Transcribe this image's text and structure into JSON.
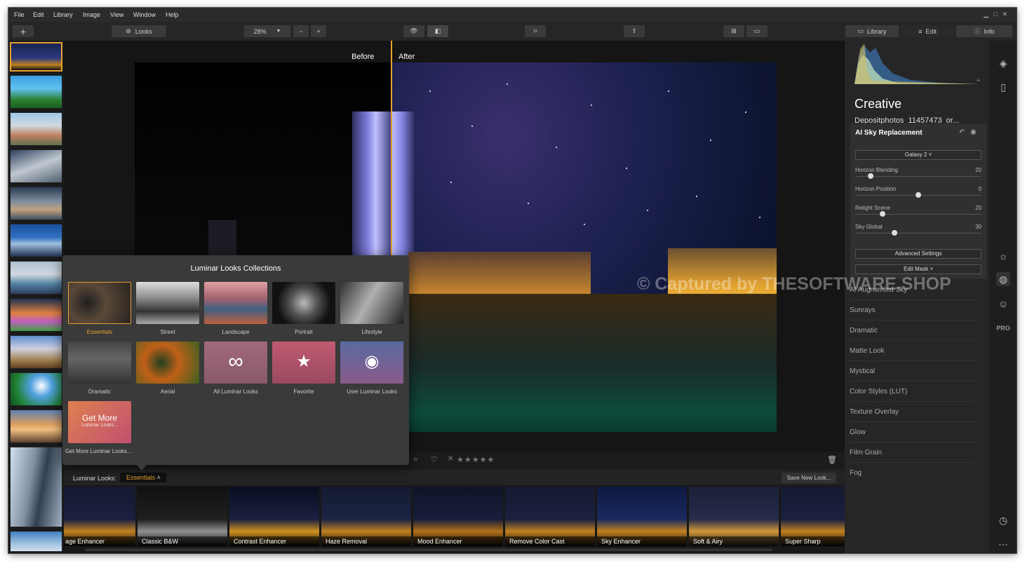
{
  "menu": [
    "File",
    "Edit",
    "Library",
    "Image",
    "View",
    "Window",
    "Help"
  ],
  "toolbar": {
    "looks": "Looks",
    "zoom": "28%",
    "library": "Library",
    "edit": "Edit",
    "info": "Info"
  },
  "compare": {
    "before": "Before",
    "after": "After"
  },
  "popup": {
    "title": "Luminar Looks Collections",
    "collections": [
      "Essentials",
      "Street",
      "Landscape",
      "Portrait",
      "Lifestyle",
      "Dramatic",
      "Aerial",
      "All Luminar Looks",
      "Favorite",
      "User Luminar Looks"
    ],
    "get_more_title": "Get More",
    "get_more_sub": "Luminar Looks...",
    "get_more_caption": "Get More Luminar Looks..."
  },
  "looksbar": {
    "label": "Luminar Looks:",
    "selected": "Essentials",
    "save": "Save New Look..."
  },
  "looks": [
    "age Enhancer",
    "Classic B&W",
    "Contrast Enhancer",
    "Haze Removal",
    "Mood Enhancer",
    "Remove Color Cast",
    "Sky Enhancer",
    "Soft & Airy",
    "Super Sharp"
  ],
  "panel": {
    "section": "Creative",
    "filename": "Depositphotos_11457473_or...",
    "tool": "AI Sky Replacement",
    "sky_select": "Galaxy 2",
    "sliders": [
      {
        "label": "Horizon Blending",
        "value": "20",
        "level": 0.12
      },
      {
        "label": "Horizon Position",
        "value": "0",
        "level": 0.5
      },
      {
        "label": "Relight Scene",
        "value": "20",
        "level": 0.22
      },
      {
        "label": "Sky Global",
        "value": "30",
        "level": 0.31
      }
    ],
    "advanced": "Advanced Settings",
    "mask": "Edit Mask",
    "categories": [
      "AI Augmented Sky",
      "Sunrays",
      "Dramatic",
      "Matte Look",
      "Mystical",
      "Color Styles (LUT)",
      "Texture Overlay",
      "Glow",
      "Film Grain",
      "Fog"
    ],
    "pro": "PRO"
  },
  "rating": {
    "stars": "★★★★★"
  },
  "watermark": "© Captured by THESOFTWARE.SHOP"
}
